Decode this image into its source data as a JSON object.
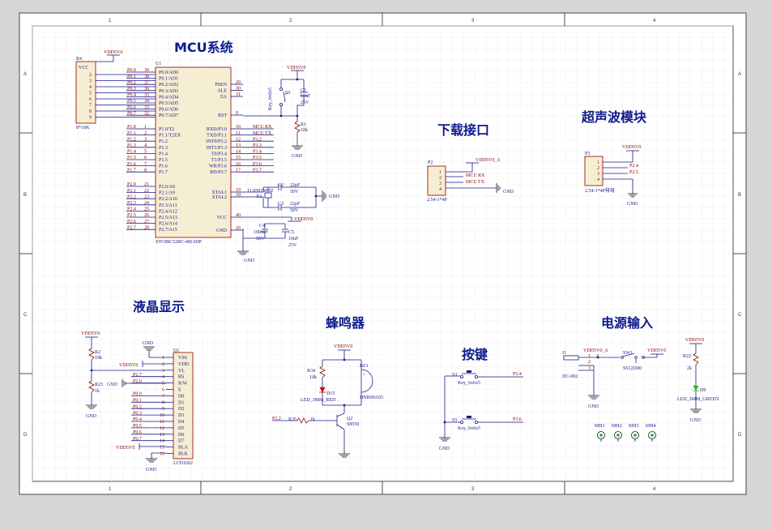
{
  "titles": {
    "mcu": "MCU系统",
    "download": "下载接口",
    "ultrasonic": "超声波模块",
    "lcd": "液晶显示",
    "buzzer": "蜂鸣器",
    "keys": "按键",
    "power": "电源输入"
  },
  "border": {
    "cols": [
      "1",
      "2",
      "3",
      "4"
    ],
    "rows": [
      "A",
      "B",
      "C",
      "D"
    ]
  },
  "r4": {
    "ref": "R4",
    "value": "8*10K",
    "vcc": "VCC",
    "supply": "VDD5V0",
    "pins": [
      "2",
      "3",
      "4",
      "5",
      "6",
      "7",
      "8",
      "9"
    ]
  },
  "u1": {
    "ref": "U1",
    "part": "STC89C52RC-40I-DIP",
    "p0_nets": [
      "P0.0",
      "P0.1",
      "P0.2",
      "P0.3",
      "P0.4",
      "P0.5",
      "P0.6",
      "P0.7"
    ],
    "p0_nums": [
      "39",
      "38",
      "37",
      "36",
      "35",
      "34",
      "33",
      "32"
    ],
    "p0_names": [
      "P0.0/AD0",
      "P0.1/AD1",
      "P0.2/AD2",
      "P0.3/AD3",
      "P0.4/AD4",
      "P0.5/AD5",
      "P0.6/AD6",
      "P0.7/AD7"
    ],
    "p1_nets": [
      "P1.0",
      "P1.1",
      "P1.2",
      "P1.3",
      "P1.4",
      "P1.5",
      "P1.6",
      "P1.7"
    ],
    "p1_nums": [
      "1",
      "2",
      "3",
      "4",
      "5",
      "6",
      "7",
      "8"
    ],
    "p1_names": [
      "P1.0/T2",
      "P1.1/T2EX",
      "P1.2",
      "P1.3",
      "P1.4",
      "P1.5",
      "P1.6",
      "P1.7"
    ],
    "p2_nets": [
      "P2.0",
      "P2.1",
      "P2.2",
      "P2.3",
      "P2.4",
      "P2.5",
      "P2.6",
      "P2.7"
    ],
    "p2_nums": [
      "21",
      "22",
      "23",
      "24",
      "25",
      "26",
      "27",
      "28"
    ],
    "p2_names": [
      "P2.0/A8",
      "P2.1/A9",
      "P2.2/A10",
      "P2.3/A11",
      "P2.4/A12",
      "P2.5/A13",
      "P2.6/A14",
      "P2.7/A15"
    ],
    "right_top_names": [
      "PSEN",
      "ALE",
      "EA"
    ],
    "right_top_nums": [
      "29",
      "30",
      "31"
    ],
    "rst_name": "RST",
    "rst_num": "9",
    "p3_names": [
      "RXD/P3.0",
      "TXD/P3.1",
      "INT0/P3.2",
      "INT1/P3.3",
      "T0/P3.4",
      "T1/P3.5",
      "WR/P3.6",
      "RD/P3.7"
    ],
    "p3_nums": [
      "10",
      "11",
      "12",
      "13",
      "14",
      "15",
      "16",
      "17"
    ],
    "p3_nets": [
      "MCU RX",
      "MCU TX",
      "P3.2",
      "P3.3",
      "P3.4",
      "P3.5",
      "P3.6",
      "P3.7"
    ],
    "xtal_names": [
      "XTAL1",
      "XTAL2"
    ],
    "xtal_nums": [
      "19",
      "18"
    ],
    "vcc_name": "VCC",
    "vcc_num": "40",
    "gnd_name": "GND",
    "gnd_num": "20"
  },
  "reset": {
    "supply": "VDD5V0",
    "s0": "S0",
    "s0_type": "Key_6x6x5",
    "c1": "C1",
    "c1_val": "10uF",
    "c1_v": "25V",
    "r1": "R1",
    "r1_val": "10k",
    "gnd": "GND"
  },
  "crystal": {
    "x1": "X1",
    "x1_val": "11.0592MHZ",
    "c2": "C2",
    "c2_val": "22pF",
    "c2_v": "50V",
    "c3": "C3",
    "c3_val": "22pF",
    "c3_v": "50V",
    "gnd": "GND"
  },
  "decoupling": {
    "supply": "VDD5V0",
    "c4": "C4",
    "c4_val": "100nF",
    "c4_v": "50V",
    "c5": "C5",
    "c5_val": "10uF",
    "c5_v": "25V",
    "gnd": "GND"
  },
  "p2": {
    "ref": "P2",
    "part": "2.54-1*4P",
    "supply": "VDD5V0_A",
    "pins": [
      "1",
      "2",
      "3",
      "4"
    ],
    "nets": [
      "MCU RX",
      "MCU TX"
    ],
    "gnd": "GND"
  },
  "p3": {
    "ref": "P3",
    "part": "2.54-1*4P排母",
    "supply": "VDD5V0",
    "pins": [
      "1",
      "2",
      "3",
      "4"
    ],
    "nets": [
      "P2.4",
      "P2.5"
    ],
    "gnd": "GND"
  },
  "lcd": {
    "supply": "VDD5V0",
    "r2": "R2",
    "r2_val": "10k",
    "r23": "R23",
    "r23_val": "1k",
    "gnd": "GND",
    "ref": "Q1",
    "part": "LCD1602",
    "pin_names": [
      "VSS",
      "VDD",
      "VL",
      "RS",
      "R/W",
      "E",
      "D0",
      "D1",
      "D2",
      "D3",
      "D4",
      "D5",
      "D6",
      "D7",
      "BLA",
      "BLK"
    ],
    "pin_nums": [
      "1",
      "2",
      "3",
      "4",
      "5",
      "6",
      "7",
      "8",
      "9",
      "10",
      "11",
      "12",
      "13",
      "14",
      "15",
      "16"
    ],
    "nets": [
      "P2.7",
      "P2.6",
      "P0.0",
      "P0.1",
      "P0.2",
      "P0.3",
      "P0.4",
      "P0.5",
      "P0.6",
      "P0.7"
    ],
    "vdd_label": "VDD5V0",
    "bla_label": "VDD5V0"
  },
  "buzzer": {
    "supply": "VDD5V0",
    "r34": "R34",
    "r34_val": "10k",
    "d15": "D15",
    "d15_part": "LED_3MM_RED",
    "bz1": "BZ1",
    "bz1_part": "HNB09A05",
    "q2": "Q2",
    "q2_part": "S8550",
    "r35": "R35",
    "r35_val": "1k",
    "net": "P2.2"
  },
  "keys": {
    "s3": "S3",
    "s5": "S5",
    "type": "Key_6x6x5",
    "net_s3": "P3.4",
    "net_s5": "P3.6",
    "gnd": "GND"
  },
  "power": {
    "j1": "J1",
    "j1_part": "DC-002",
    "j1_label": "VDD5V0_A",
    "sw1": "SW1",
    "sw1_part": "SS12D00",
    "out": "VDD5V0",
    "pins": [
      "1",
      "2",
      "3"
    ],
    "gnd": "GND",
    "r22": "R22",
    "r22_val": "2k",
    "d9": "D9",
    "d9_part": "LED_3MM_GREEN",
    "supply_led": "VDD5V0",
    "gnd2": "GND",
    "mh": [
      "MH1",
      "MH2",
      "MH3",
      "MH4"
    ]
  }
}
